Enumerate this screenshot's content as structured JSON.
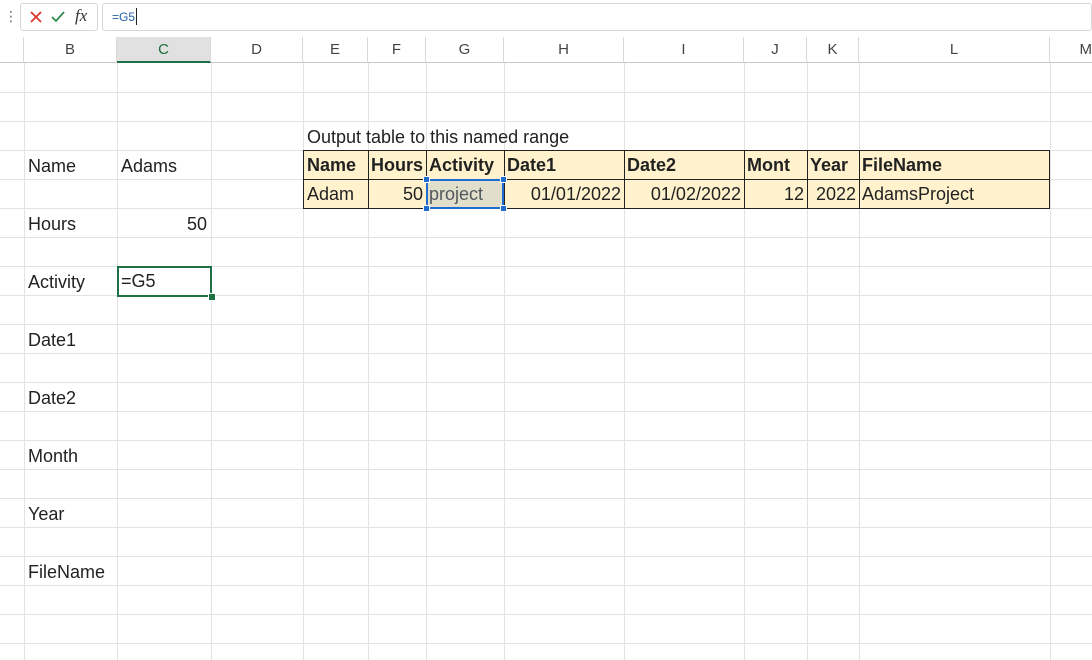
{
  "formula_bar": {
    "formula": "=G5",
    "fx_label": "fx"
  },
  "columns": [
    "B",
    "C",
    "D",
    "E",
    "F",
    "G",
    "H",
    "I",
    "J",
    "K",
    "L",
    "M"
  ],
  "active_column": "C",
  "labels": {
    "name": "Name",
    "hours": "Hours",
    "activity": "Activity",
    "date1": "Date1",
    "date2": "Date2",
    "month": "Month",
    "year": "Year",
    "filename": "FileName"
  },
  "values": {
    "name": "Adams",
    "hours": "50",
    "activity_formula": "=G5"
  },
  "output_table": {
    "caption": "Output table to this named range",
    "headers": [
      "Name",
      "Hours",
      "Activity",
      "Date1",
      "Date2",
      "Mont",
      "Year",
      "FileName"
    ],
    "row": [
      "Adam",
      "50",
      "project",
      "01/01/2022",
      "01/02/2022",
      "12",
      "2022",
      "AdamsProject"
    ],
    "fill_color": "#fff2cc"
  },
  "colors": {
    "selection_green": "#1e7145",
    "reference_blue": "#1f6ecf"
  }
}
